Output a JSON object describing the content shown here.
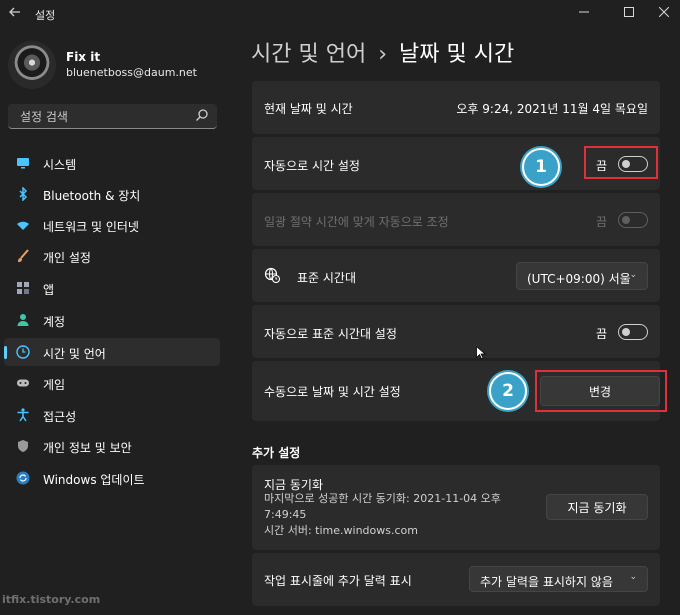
{
  "window": {
    "title": "설정",
    "back_icon": "arrow-left-icon",
    "minimize_icon": "minimize-icon",
    "maximize_icon": "maximize-icon",
    "close_icon": "close-icon"
  },
  "user": {
    "name": "Fix it",
    "email": "bluenetboss@daum.net"
  },
  "search": {
    "placeholder": "설정 검색",
    "icon": "search-icon"
  },
  "sidebar": {
    "items": [
      {
        "label": "시스템",
        "icon": "monitor-icon",
        "color": "#4cc2ff",
        "active": false
      },
      {
        "label": "Bluetooth & 장치",
        "icon": "bluetooth-icon",
        "color": "#4cc2ff",
        "active": false
      },
      {
        "label": "네트워크 및 인터넷",
        "icon": "wifi-icon",
        "color": "#4cc2ff",
        "active": false
      },
      {
        "label": "개인 설정",
        "icon": "brush-icon",
        "color": "#e8a060",
        "active": false
      },
      {
        "label": "앱",
        "icon": "apps-icon",
        "color": "#a0a8b8",
        "active": false
      },
      {
        "label": "계정",
        "icon": "person-icon",
        "color": "#3cc7a5",
        "active": false
      },
      {
        "label": "시간 및 언어",
        "icon": "clock-globe-icon",
        "color": "#4cc2ff",
        "active": true
      },
      {
        "label": "게임",
        "icon": "gamepad-icon",
        "color": "#bcbcbc",
        "active": false
      },
      {
        "label": "접근성",
        "icon": "accessibility-icon",
        "color": "#4cc2ff",
        "active": false
      },
      {
        "label": "개인 정보 및 보안",
        "icon": "shield-icon",
        "color": "#9a9a9a",
        "active": false
      },
      {
        "label": "Windows 업데이트",
        "icon": "update-icon",
        "color": "#4cc2ff",
        "active": false
      }
    ]
  },
  "breadcrumb": {
    "parent": "시간 및 언어",
    "separator": "›",
    "current": "날짜 및 시간"
  },
  "settings": {
    "current_datetime": {
      "label": "현재 날짜 및 시간",
      "value": "오후 9:24, 2021년 11월 4일 목요일"
    },
    "auto_time": {
      "label": "자동으로 시간 설정",
      "state": "끔"
    },
    "dst": {
      "label": "일광 절약 시간에 맞게 자동으로 조정",
      "state": "끔"
    },
    "timezone": {
      "label": "표준 시간대",
      "value": "(UTC+09:00) 서울",
      "icon": "globe-clock-icon"
    },
    "auto_timezone": {
      "label": "자동으로 표준 시간대 설정",
      "state": "끔"
    },
    "manual": {
      "label": "수동으로 날짜 및 시간 설정",
      "button": "변경"
    }
  },
  "more": {
    "title": "추가 설정",
    "sync": {
      "title": "지금 동기화",
      "line1": "마지막으로 성공한 시간 동기화: 2021-11-04 오후",
      "line2": "7:49:45",
      "line3": "시간 서버: time.windows.com",
      "button": "지금 동기화"
    },
    "calendar": {
      "label": "작업 표시줄에 추가 달력 표시",
      "value": "추가 달력을 표시하지 않음"
    }
  },
  "annotations": {
    "badge1": "1",
    "badge2": "2",
    "highlight_color": "#e0313a",
    "badge_color": "#3aa2c9"
  },
  "watermark": "itfix.tistory.com",
  "colors": {
    "background": "#202020",
    "card": "#2b2b2b",
    "accent": "#60cdff"
  }
}
